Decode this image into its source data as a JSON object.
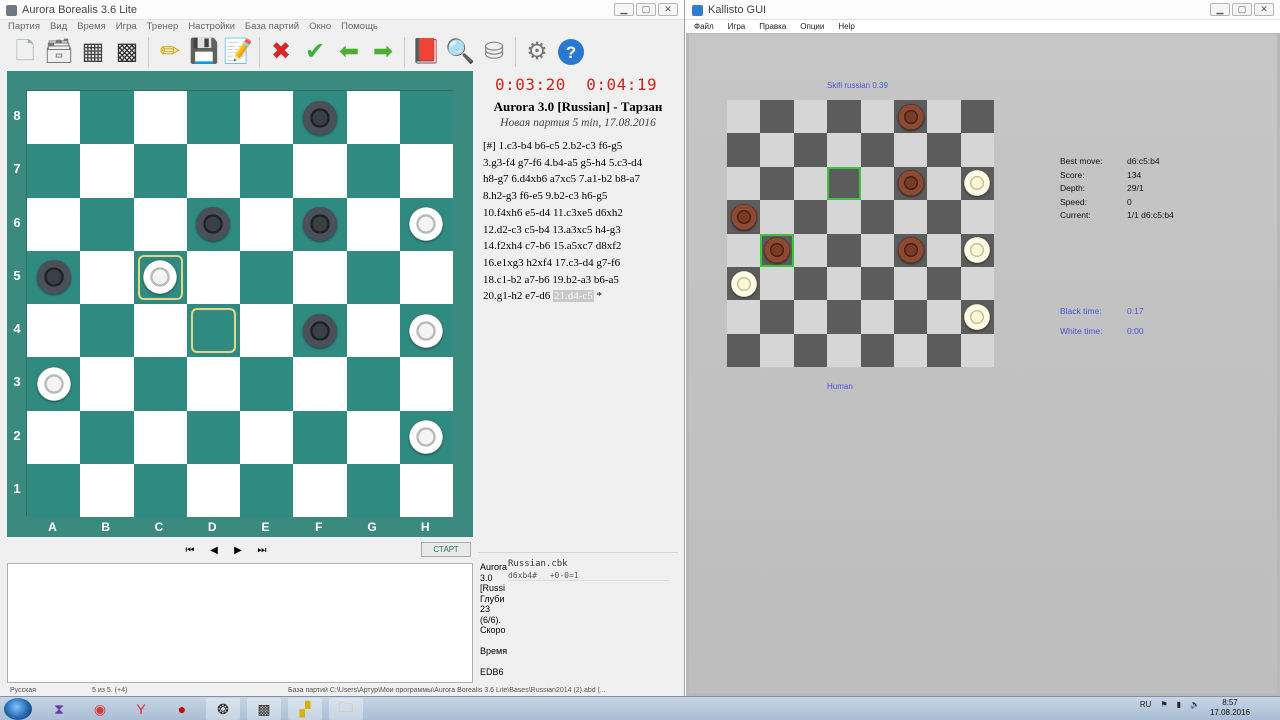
{
  "aurora": {
    "title": "Aurora Borealis 3.6 Lite",
    "menu": [
      "Партия",
      "Вид",
      "Время",
      "Игра",
      "Тренер",
      "Настройки",
      "База партий",
      "Окно",
      "Помощь"
    ],
    "toolbar_icons": [
      {
        "name": "new-file-icon",
        "glyph": "🗋"
      },
      {
        "name": "open-box-icon",
        "glyph": "🗃"
      },
      {
        "name": "board-setup-icon",
        "glyph": "▦"
      },
      {
        "name": "checkered-board-icon",
        "glyph": "▩"
      },
      {
        "name": "edit-pencil-icon",
        "glyph": "✏"
      },
      {
        "name": "save-icon",
        "glyph": "💾"
      },
      {
        "name": "edit-note-icon",
        "glyph": "📝"
      },
      {
        "name": "cancel-cross-icon",
        "glyph": "✖"
      },
      {
        "name": "confirm-check-icon",
        "glyph": "✔"
      },
      {
        "name": "back-arrow-icon",
        "glyph": "⬅"
      },
      {
        "name": "forward-arrow-icon",
        "glyph": "➡"
      },
      {
        "name": "book-icon",
        "glyph": "📕"
      },
      {
        "name": "search-icon",
        "glyph": "🔍"
      },
      {
        "name": "database-icon",
        "glyph": "⛁"
      },
      {
        "name": "gear-icon",
        "glyph": "⚙"
      },
      {
        "name": "help-icon",
        "glyph": "?"
      }
    ],
    "ranks": [
      "8",
      "7",
      "6",
      "5",
      "4",
      "3",
      "2",
      "1"
    ],
    "files": [
      "A",
      "B",
      "C",
      "D",
      "E",
      "F",
      "G",
      "H"
    ],
    "pieces": [
      {
        "sq": "f8",
        "color": "black"
      },
      {
        "sq": "d6",
        "color": "black"
      },
      {
        "sq": "f6",
        "color": "black"
      },
      {
        "sq": "h6",
        "color": "white"
      },
      {
        "sq": "a5",
        "color": "black"
      },
      {
        "sq": "c5",
        "color": "white"
      },
      {
        "sq": "f4",
        "color": "black"
      },
      {
        "sq": "h4",
        "color": "white"
      },
      {
        "sq": "a3",
        "color": "white"
      },
      {
        "sq": "h2",
        "color": "white"
      }
    ],
    "selected": [
      "c5",
      "d4"
    ],
    "clock_white": "0:03:20",
    "clock_black": "0:04:19",
    "players": "Aurora 3.0 [Russian] - Тарзан",
    "game_info": "Новая партия 5 min, 17.08.2016",
    "notation_lines": [
      "[#] 1.c3-b4 b6-c5 2.b2-c3 f6-g5",
      "3.g3-f4 g7-f6 4.b4-a5 g5-h4 5.c3-d4",
      "h8-g7 6.d4xb6 a7xc5 7.a1-b2 b8-a7",
      "8.h2-g3 f6-e5 9.b2-c3 h6-g5",
      "10.f4xh6 e5-d4 11.c3xe5 d6xh2",
      "12.d2-c3 c5-b4 13.a3xc5 h4-g3",
      "14.f2xh4 c7-b6 15.a5xc7 d8xf2",
      "16.e1xg3 h2xf4 17.c3-d4 g7-f6",
      "18.c1-b2 a7-b6 19.b2-a3 b6-a5"
    ],
    "notation_last_prefix": "20.g1-h2 e7-d6 ",
    "notation_last_move": "21.d4-c5",
    "notation_last_suffix": " *",
    "nav": [
      "⏮",
      "◀",
      "▶",
      "⏭"
    ],
    "start_label": "СТАРТ",
    "engine": {
      "labels": [
        "Aurora",
        "3.0",
        "[Russi",
        "Глуби",
        "23",
        "(6/6).",
        "Скоро",
        "",
        "Время",
        "",
        "EDB6"
      ],
      "book_file": "Russian.cbk",
      "book_move": "d6xb4#",
      "book_score": "+0-0=1"
    },
    "status": {
      "lang": "Русская",
      "rule": "5 из 5. (+4)",
      "db_path": "База партий C:\\Users\\Артур\\Мои программы\\Aurora Borealis 3.6 Lite\\Bases\\Russian2014 (2).abd (..."
    }
  },
  "kallisto": {
    "title": "Kallisto GUI",
    "menu": [
      "Файл",
      "Игра",
      "Правка",
      "Опции",
      "Help"
    ],
    "top_player": "Skifi russian 0.39",
    "bottom_player": "Human",
    "pieces": [
      {
        "r": 0,
        "c": 5,
        "color": "black"
      },
      {
        "r": 2,
        "c": 5,
        "color": "black"
      },
      {
        "r": 2,
        "c": 7,
        "color": "white"
      },
      {
        "r": 3,
        "c": 0,
        "color": "black"
      },
      {
        "r": 4,
        "c": 1,
        "color": "black"
      },
      {
        "r": 4,
        "c": 5,
        "color": "black"
      },
      {
        "r": 4,
        "c": 7,
        "color": "white"
      },
      {
        "r": 5,
        "c": 0,
        "color": "white"
      },
      {
        "r": 6,
        "c": 7,
        "color": "white"
      }
    ],
    "lastmove": [
      {
        "r": 2,
        "c": 3
      },
      {
        "r": 4,
        "c": 1
      }
    ],
    "stats": [
      {
        "label": "Best move:",
        "value": "d6:c5:b4"
      },
      {
        "label": "Score:",
        "value": "134"
      },
      {
        "label": "Depth:",
        "value": "29/1"
      },
      {
        "label": "Speed:",
        "value": "0"
      },
      {
        "label": "Current:",
        "value": "1/1 d6:c5:b4"
      }
    ],
    "times": [
      {
        "label": "Black time:",
        "value": "0:17"
      },
      {
        "label": "White time:",
        "value": "0:00"
      }
    ]
  },
  "taskbar": {
    "apps": [
      {
        "name": "visual-studio-icon",
        "glyph": "⧗"
      },
      {
        "name": "chrome-icon",
        "glyph": "◉"
      },
      {
        "name": "yandex-browser-icon",
        "glyph": "Y"
      },
      {
        "name": "opera-icon",
        "glyph": "●"
      },
      {
        "name": "checkers-app-icon",
        "glyph": "❂"
      },
      {
        "name": "aurora-app-icon",
        "glyph": "▩"
      },
      {
        "name": "kallisto-app-icon",
        "glyph": "▞"
      },
      {
        "name": "folder-icon",
        "glyph": "🗀"
      }
    ],
    "lang": "RU",
    "time": "8:57",
    "date": "17.08.2016"
  }
}
